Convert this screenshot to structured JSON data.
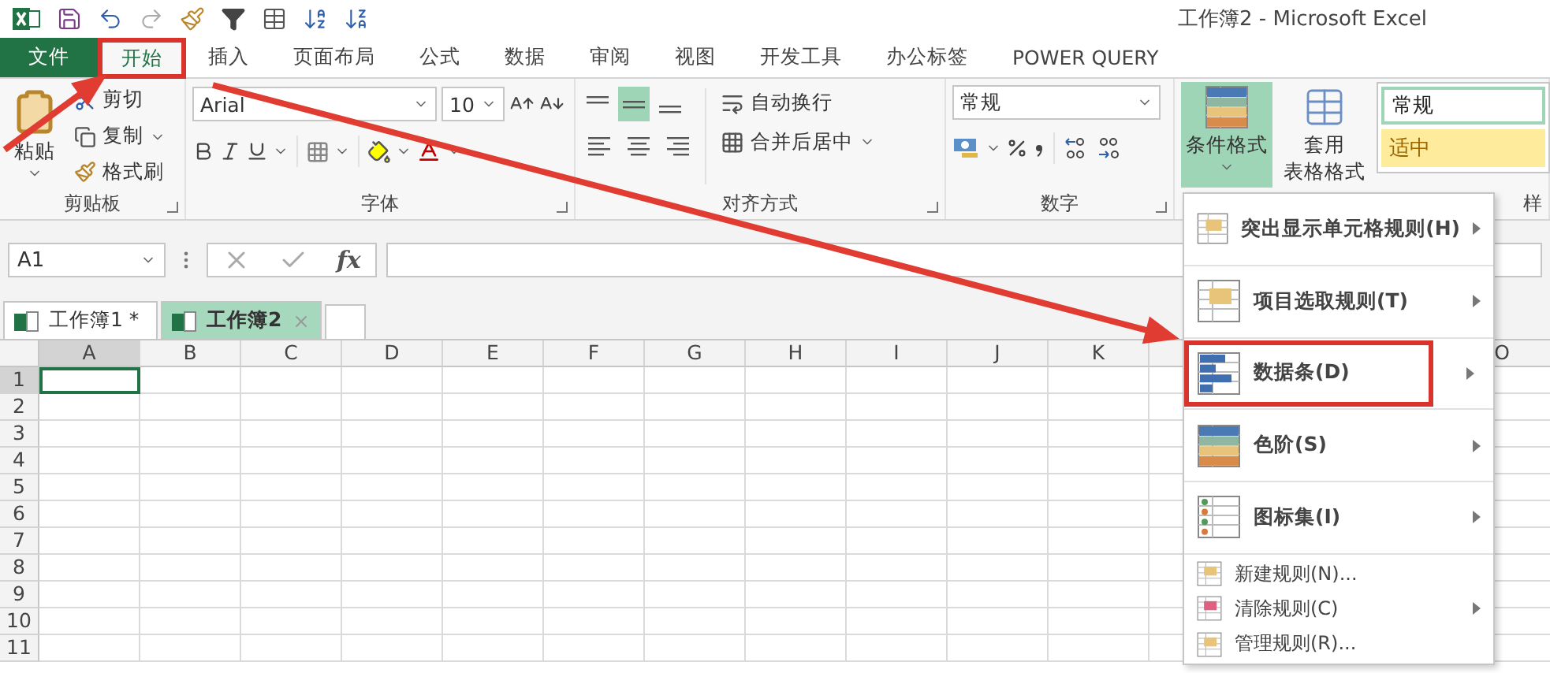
{
  "window": {
    "title": "工作簿2 - Microsoft Excel"
  },
  "ribbon_tabs": [
    {
      "label": "文件",
      "kind": "file",
      "selected": false,
      "outlined": false
    },
    {
      "label": "开始",
      "kind": "tab",
      "selected": true,
      "outlined": true
    },
    {
      "label": "插入",
      "kind": "tab",
      "selected": false,
      "outlined": false
    },
    {
      "label": "页面布局",
      "kind": "tab",
      "selected": false,
      "outlined": false
    },
    {
      "label": "公式",
      "kind": "tab",
      "selected": false,
      "outlined": false
    },
    {
      "label": "数据",
      "kind": "tab",
      "selected": false,
      "outlined": false
    },
    {
      "label": "审阅",
      "kind": "tab",
      "selected": false,
      "outlined": false
    },
    {
      "label": "视图",
      "kind": "tab",
      "selected": false,
      "outlined": false
    },
    {
      "label": "开发工具",
      "kind": "tab",
      "selected": false,
      "outlined": false
    },
    {
      "label": "办公标签",
      "kind": "tab",
      "selected": false,
      "outlined": false
    },
    {
      "label": "POWER QUERY",
      "kind": "tab",
      "selected": false,
      "outlined": false
    }
  ],
  "clipboard": {
    "title": "剪贴板",
    "paste": "粘贴",
    "cut": "剪切",
    "copy": "复制",
    "format_painter": "格式刷"
  },
  "font": {
    "title": "字体",
    "name": "Arial",
    "size": "10"
  },
  "alignment": {
    "title": "对齐方式",
    "vertical": [
      {
        "kind": "top",
        "selected": false
      },
      {
        "kind": "middle",
        "selected": true
      },
      {
        "kind": "bottom",
        "selected": false
      }
    ],
    "wrap_text": "自动换行",
    "merge_center": "合并后居中"
  },
  "number": {
    "title": "数字",
    "format": "常规"
  },
  "styles": {
    "title": "样",
    "conditional_formatting": {
      "label": "条件格式",
      "expanded": true
    },
    "format_as_table": [
      "套用",
      "表格格式"
    ],
    "cell_styles": [
      {
        "label": "常规",
        "kind": "normal"
      },
      {
        "label": "适中",
        "kind": "neutral"
      }
    ]
  },
  "formula_bar": {
    "name_box": "A1",
    "fx": "fx"
  },
  "workbook_tabs": [
    {
      "label": "工作簿1 *",
      "selected": false
    },
    {
      "label": "工作簿2",
      "selected": true
    }
  ],
  "sheet": {
    "columns": [
      {
        "label": "A",
        "selected": true
      },
      {
        "label": "B",
        "selected": false
      },
      {
        "label": "C",
        "selected": false
      },
      {
        "label": "D",
        "selected": false
      },
      {
        "label": "E",
        "selected": false
      },
      {
        "label": "F",
        "selected": false
      },
      {
        "label": "G",
        "selected": false
      },
      {
        "label": "H",
        "selected": false
      },
      {
        "label": "I",
        "selected": false
      },
      {
        "label": "J",
        "selected": false
      },
      {
        "label": "K",
        "selected": false
      }
    ],
    "right_columns": [
      {
        "label": "O",
        "selected": false
      }
    ],
    "rows": [
      {
        "label": "1",
        "selected": true
      },
      {
        "label": "2",
        "selected": false
      },
      {
        "label": "3",
        "selected": false
      },
      {
        "label": "4",
        "selected": false
      },
      {
        "label": "5",
        "selected": false
      },
      {
        "label": "6",
        "selected": false
      },
      {
        "label": "7",
        "selected": false
      },
      {
        "label": "8",
        "selected": false
      },
      {
        "label": "9",
        "selected": false
      },
      {
        "label": "10",
        "selected": false
      },
      {
        "label": "11",
        "selected": false
      }
    ]
  },
  "menu": {
    "items": [
      {
        "kind": "highlight",
        "label": "突出显示单元格规则(H)",
        "large": true,
        "submenu": true,
        "outlined": false
      },
      {
        "kind": "top10",
        "label": "项目选取规则(T)",
        "large": true,
        "submenu": true,
        "outlined": false
      },
      {
        "kind": "databar",
        "label": "数据条(D)",
        "large": true,
        "submenu": true,
        "outlined": true
      },
      {
        "kind": "colorscale",
        "label": "色阶(S)",
        "large": true,
        "submenu": true,
        "outlined": false
      },
      {
        "kind": "iconset",
        "label": "图标集(I)",
        "large": true,
        "submenu": true,
        "outlined": false
      },
      {
        "kind": "new",
        "label": "新建规则(N)...",
        "large": false,
        "submenu": false,
        "outlined": false
      },
      {
        "kind": "clear",
        "label": "清除规则(C)",
        "large": false,
        "submenu": true,
        "outlined": false
      },
      {
        "kind": "manage",
        "label": "管理规则(R)...",
        "large": false,
        "submenu": false,
        "outlined": false
      }
    ]
  }
}
